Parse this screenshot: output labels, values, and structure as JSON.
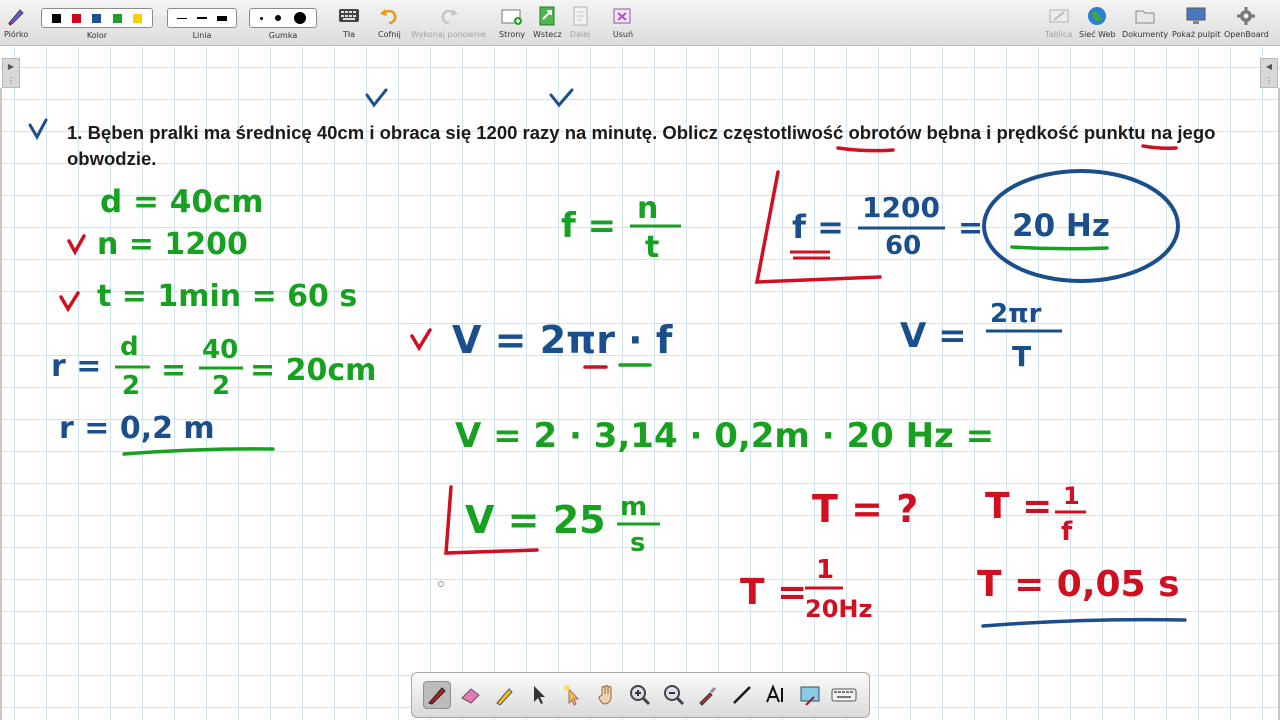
{
  "toolbar": {
    "pen": "Piórko",
    "color": "Kolor",
    "line": "Linia",
    "eraser": "Gumka",
    "backgrounds": "Tła",
    "undo": "Cofnij",
    "redo": "Wykonaj ponownie",
    "pages": "Strony",
    "insert": "Wstecz",
    "next": "Dalej",
    "delete": "Usuń",
    "board": "Tablica",
    "web": "Sieć Web",
    "documents": "Dokumenty",
    "desktop": "Pokaż pulpit",
    "openboard": "OpenBoard"
  },
  "colors": [
    "#000000",
    "#d0021b",
    "#1f4f8f",
    "#1e9e2e",
    "#f5d300"
  ],
  "problem": {
    "text_before": "1. Bęben pralki ma średnicę 40cm i obraca się 1200 razy na minutę. Oblicz ",
    "word1": "częstotliwość",
    "text_middle": " obrotów bębna i ",
    "word2": "prędkość",
    "text_after": " punktu na jego obwodzie."
  },
  "handwriting": {
    "d": "d = 40cm",
    "n": "n = 1200",
    "t": "t = 1min = 60 s",
    "r_lhs": "r =",
    "r_num_d": "d",
    "r_den_2": "2",
    "r_eq": "=",
    "r_num_40": "40",
    "r_den_2b": "2",
    "r_res": "= 20cm",
    "r2": "r = 0,2 m",
    "f_lhs": "f =",
    "f_num": "n",
    "f_den": "t",
    "f_box_lhs": "f =",
    "f_box_num": "1200",
    "f_box_den": "60",
    "f_eq": "=",
    "f_result": "20 Hz",
    "v_formula": "V = 2πr · f",
    "v_t_lhs": "V =",
    "v_t_num": "2πr",
    "v_t_den": "T",
    "v_calc": "V = 2 · 3,14 · 0,2m · 20 Hz =",
    "v_result": "V = 25",
    "v_unit_num": "m",
    "v_unit_den": "s",
    "T_q": "T = ?",
    "T_def_lhs": "T =",
    "T_def_num": "1",
    "T_def_den": "f",
    "T_calc_lhs": "T =",
    "T_calc_num": "1",
    "T_calc_den": "20Hz",
    "T_result": "T = 0,05 s"
  },
  "ink_colors": {
    "green": "#18a020",
    "blue": "#1a4f8c",
    "red": "#d01020"
  },
  "palette_tools": [
    "pen-icon",
    "eraser-icon",
    "highlighter-icon",
    "pointer-icon",
    "laser-icon",
    "hand-icon",
    "zoom-in-icon",
    "zoom-out-icon",
    "pipette-icon",
    "line-icon",
    "text-icon",
    "capture-icon",
    "keyboard-icon"
  ]
}
